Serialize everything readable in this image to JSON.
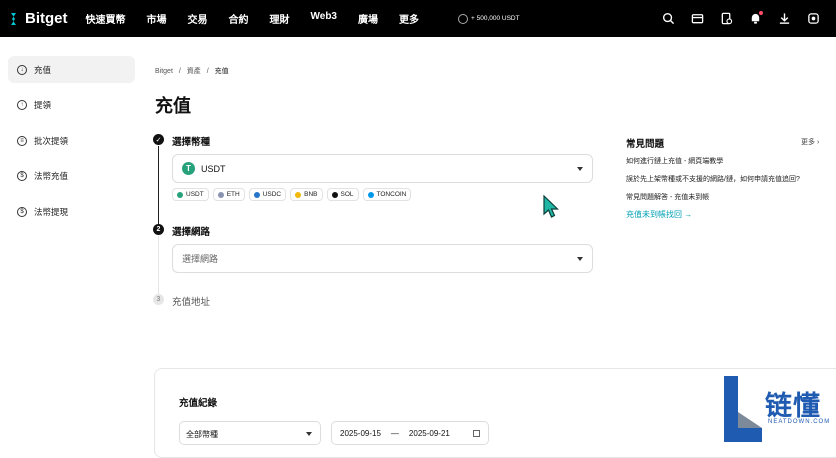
{
  "brand": {
    "name": "Bitget",
    "color": "#00c3d0"
  },
  "nav": {
    "items": [
      "快速買幣",
      "市場",
      "交易",
      "合約",
      "理財",
      "Web3",
      "廣場",
      "更多"
    ],
    "promo": "+ 500,000 USDT"
  },
  "header_icons": [
    "search-icon",
    "wallet-icon",
    "orders-icon",
    "bell-icon",
    "download-icon",
    "settings-icon"
  ],
  "sidebar": {
    "items": [
      {
        "label": "充值",
        "icon": "deposit-icon",
        "active": true
      },
      {
        "label": "提領",
        "icon": "withdraw-icon",
        "active": false
      },
      {
        "label": "批次提領",
        "icon": "batch-withdraw-icon",
        "active": false
      },
      {
        "label": "法幣充值",
        "icon": "fiat-deposit-icon",
        "active": false
      },
      {
        "label": "法幣提現",
        "icon": "fiat-withdraw-icon",
        "active": false
      }
    ]
  },
  "breadcrumb": {
    "items": [
      "Bitget",
      "資產",
      "充值"
    ],
    "separator": "/"
  },
  "page_title": "充值",
  "steps": {
    "coin": {
      "label": "選擇幣種",
      "value": "USDT",
      "chips": [
        {
          "label": "USDT",
          "color": "#26a17b"
        },
        {
          "label": "ETH",
          "color": "#8a92b2"
        },
        {
          "label": "USDC",
          "color": "#2775ca"
        },
        {
          "label": "BNB",
          "color": "#f0b90b"
        },
        {
          "label": "SOL",
          "color": "#111111"
        },
        {
          "label": "TONCOIN",
          "color": "#0098ea"
        }
      ]
    },
    "network": {
      "number": "2",
      "label": "選擇網路",
      "placeholder": "選擇網路"
    },
    "address": {
      "number": "3",
      "label": "充值地址"
    }
  },
  "faq": {
    "title": "常見問題",
    "more": "更多",
    "items": [
      "如何進行鏈上充值 - 網頁端教學",
      "誤於先上架幣種或不支援的網路/鏈，如何申請充值追回?",
      "常見問題解答 - 充值未到帳"
    ],
    "link": "充值未到帳找回"
  },
  "records": {
    "title": "充值紀錄",
    "coin_filter": "全部幣種",
    "date_start": "2025-09-15",
    "date_sep": "—",
    "date_end": "2025-09-21"
  },
  "watermark": {
    "main": "链懂",
    "sub": "NEATDOWN.COM"
  }
}
